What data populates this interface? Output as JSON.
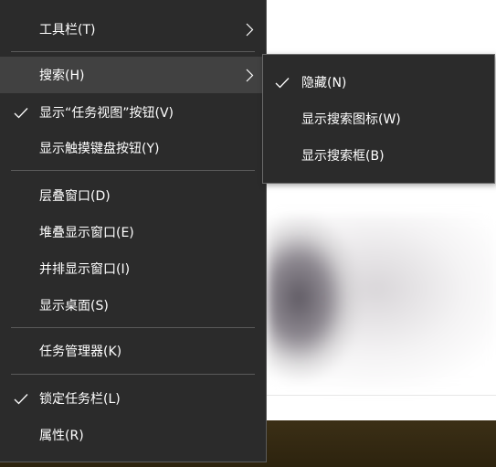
{
  "context_menu": {
    "items": [
      {
        "label": "工具栏(T)",
        "has_submenu": true,
        "checked": false
      },
      {
        "label": "搜索(H)",
        "has_submenu": true,
        "checked": false,
        "highlighted": true
      },
      {
        "label": "显示“任务视图”按钮(V)",
        "checked": true
      },
      {
        "label": "显示触摸键盘按钮(Y)",
        "checked": false
      },
      {
        "label": "层叠窗口(D)",
        "checked": false
      },
      {
        "label": "堆叠显示窗口(E)",
        "checked": false
      },
      {
        "label": "并排显示窗口(I)",
        "checked": false
      },
      {
        "label": "显示桌面(S)",
        "checked": false
      },
      {
        "label": "任务管理器(K)",
        "checked": false
      },
      {
        "label": "锁定任务栏(L)",
        "checked": true
      },
      {
        "label": "属性(R)",
        "checked": false
      }
    ]
  },
  "search_submenu": {
    "items": [
      {
        "label": "隐藏(N)",
        "checked": true
      },
      {
        "label": "显示搜索图标(W)",
        "checked": false
      },
      {
        "label": "显示搜索框(B)",
        "checked": false
      }
    ]
  },
  "icons": {
    "check": "checkmark-icon",
    "submenu_arrow": "chevron-right-icon"
  },
  "colors": {
    "menu_background": "#2b2b2b",
    "menu_highlight": "#414141",
    "menu_text": "#ffffff",
    "separator": "#5a5a5a"
  }
}
